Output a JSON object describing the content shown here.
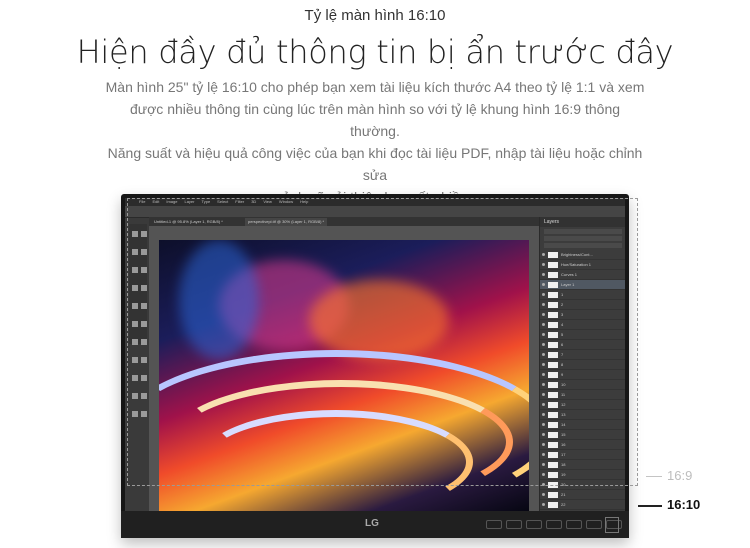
{
  "eyebrow": "Tỷ lệ màn hình 16:10",
  "headline": "Hiện đầy đủ thông tin bị ẩn trước đây",
  "description": [
    "Màn hình 25\" tỷ lệ 16:10 cho phép bạn xem tài liệu kích thước A4 theo tỷ lệ 1:1 và xem",
    "được nhiều thông tin cùng lúc trên màn hình so với tỷ lệ khung hình 16:9 thông thường.",
    "Năng suất và hiệu quả công việc của bạn khi đọc tài liệu PDF, nhập tài liệu hoặc chỉnh sửa",
    "ảnh.sẽ cải thiện hơn rất nhiều"
  ],
  "monitor": {
    "brand_logo": "LG",
    "app_menu": [
      "File",
      "Edit",
      "Image",
      "Layer",
      "Type",
      "Select",
      "Filter",
      "3D",
      "View",
      "Window",
      "Help"
    ],
    "doc_tabs": [
      "Untitled-1 @ 95.8% (Layer 1, RGB/8) *",
      "perspectivepi.tif @ 30% (Layer 1, RGB/8) *"
    ],
    "panel_title": "Layers",
    "panel_kind": "Kind",
    "blend_mode": "Normal",
    "opacity_label": "Opacity:",
    "opacity_value": "100%",
    "layers": [
      {
        "name": "Brightness/Cont...",
        "selected": false
      },
      {
        "name": "Hue/Saturation 1",
        "selected": false
      },
      {
        "name": "Curves 1",
        "selected": false
      },
      {
        "name": "Layer 1",
        "selected": true
      },
      {
        "name": "1"
      },
      {
        "name": "2"
      },
      {
        "name": "3"
      },
      {
        "name": "4"
      },
      {
        "name": "5"
      },
      {
        "name": "6"
      },
      {
        "name": "7"
      },
      {
        "name": "8"
      },
      {
        "name": "9"
      },
      {
        "name": "10"
      },
      {
        "name": "11"
      },
      {
        "name": "12"
      },
      {
        "name": "13"
      },
      {
        "name": "14"
      },
      {
        "name": "15"
      },
      {
        "name": "16"
      },
      {
        "name": "17"
      },
      {
        "name": "18"
      },
      {
        "name": "19"
      },
      {
        "name": "20"
      },
      {
        "name": "21"
      },
      {
        "name": "22"
      }
    ]
  },
  "ratio_labels": {
    "old": "16:9",
    "new": "16:10"
  },
  "colors": {
    "old_frame": "#9a9a9a",
    "new_marker": "#222222"
  }
}
